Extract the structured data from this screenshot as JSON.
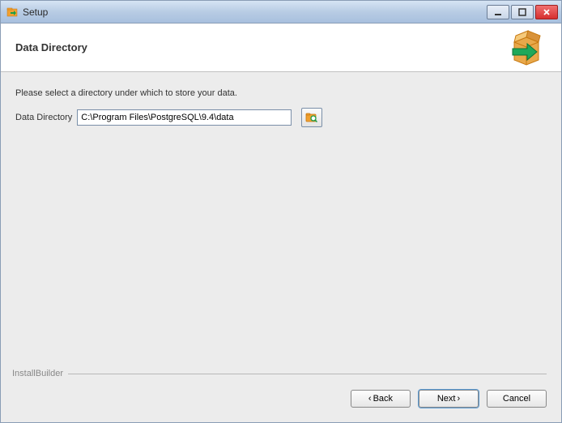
{
  "titlebar": {
    "title": "Setup"
  },
  "header": {
    "title": "Data Directory"
  },
  "content": {
    "instruction": "Please select a directory under which to store your data.",
    "field_label": "Data Directory",
    "field_value": "C:\\Program Files\\PostgreSQL\\9.4\\data"
  },
  "footer": {
    "legend": "InstallBuilder",
    "back_label": "Back",
    "next_label": "Next",
    "cancel_label": "Cancel"
  }
}
